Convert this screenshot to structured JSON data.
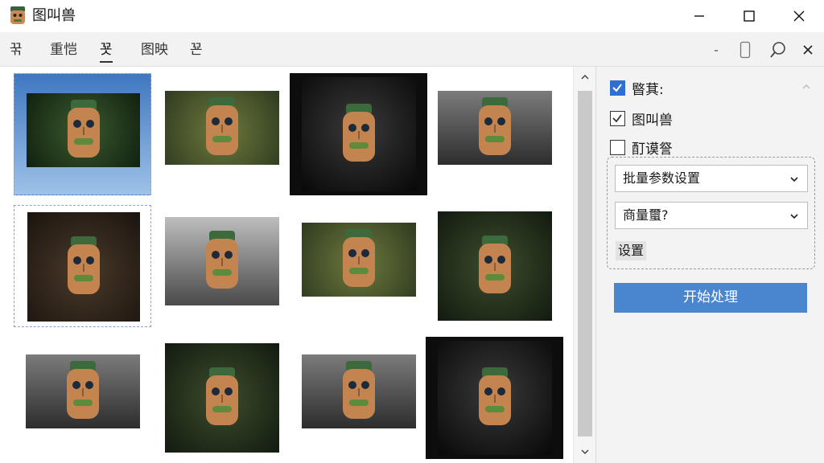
{
  "window": {
    "title": "图叫兽",
    "controls": {
      "minimize": "minimize",
      "maximize": "maximize",
      "close": "close"
    }
  },
  "toolbar": {
    "tabs": [
      {
        "label": "꾺"
      },
      {
        "label": "重恺"
      },
      {
        "label": "꾯"
      },
      {
        "label": "图映"
      },
      {
        "label": "꾠"
      }
    ],
    "icons": [
      "minimize-icon",
      "phone-icon",
      "search-icon",
      "close-icon"
    ]
  },
  "gallery": {
    "items": [
      {
        "tone": "sky"
      },
      {
        "tone": "green"
      },
      {
        "tone": "dark"
      },
      {
        "tone": "gray"
      },
      {
        "tone": "wood"
      },
      {
        "tone": "stone"
      },
      {
        "tone": "green"
      },
      {
        "tone": "forest"
      },
      {
        "tone": "gray"
      },
      {
        "tone": "forest"
      },
      {
        "tone": "gray"
      },
      {
        "tone": "dark"
      }
    ],
    "selected": [
      0,
      4
    ]
  },
  "panel": {
    "checkbox1": {
      "label": "暋萁:",
      "checked": true
    },
    "checkbox2": {
      "label": "图叫兽",
      "checked": true
    },
    "checkbox3": {
      "label": "酊谟詧",
      "checked": false
    },
    "select1": {
      "value": "批量参数设置"
    },
    "select2": {
      "value": "商量蠒?"
    },
    "settings_label": "设置",
    "primary_label": "开始处理"
  },
  "colors": {
    "accent": "#4a86d0",
    "checkbox_blue": "#2f6fd0",
    "panel_bg": "#f3f3f3"
  }
}
